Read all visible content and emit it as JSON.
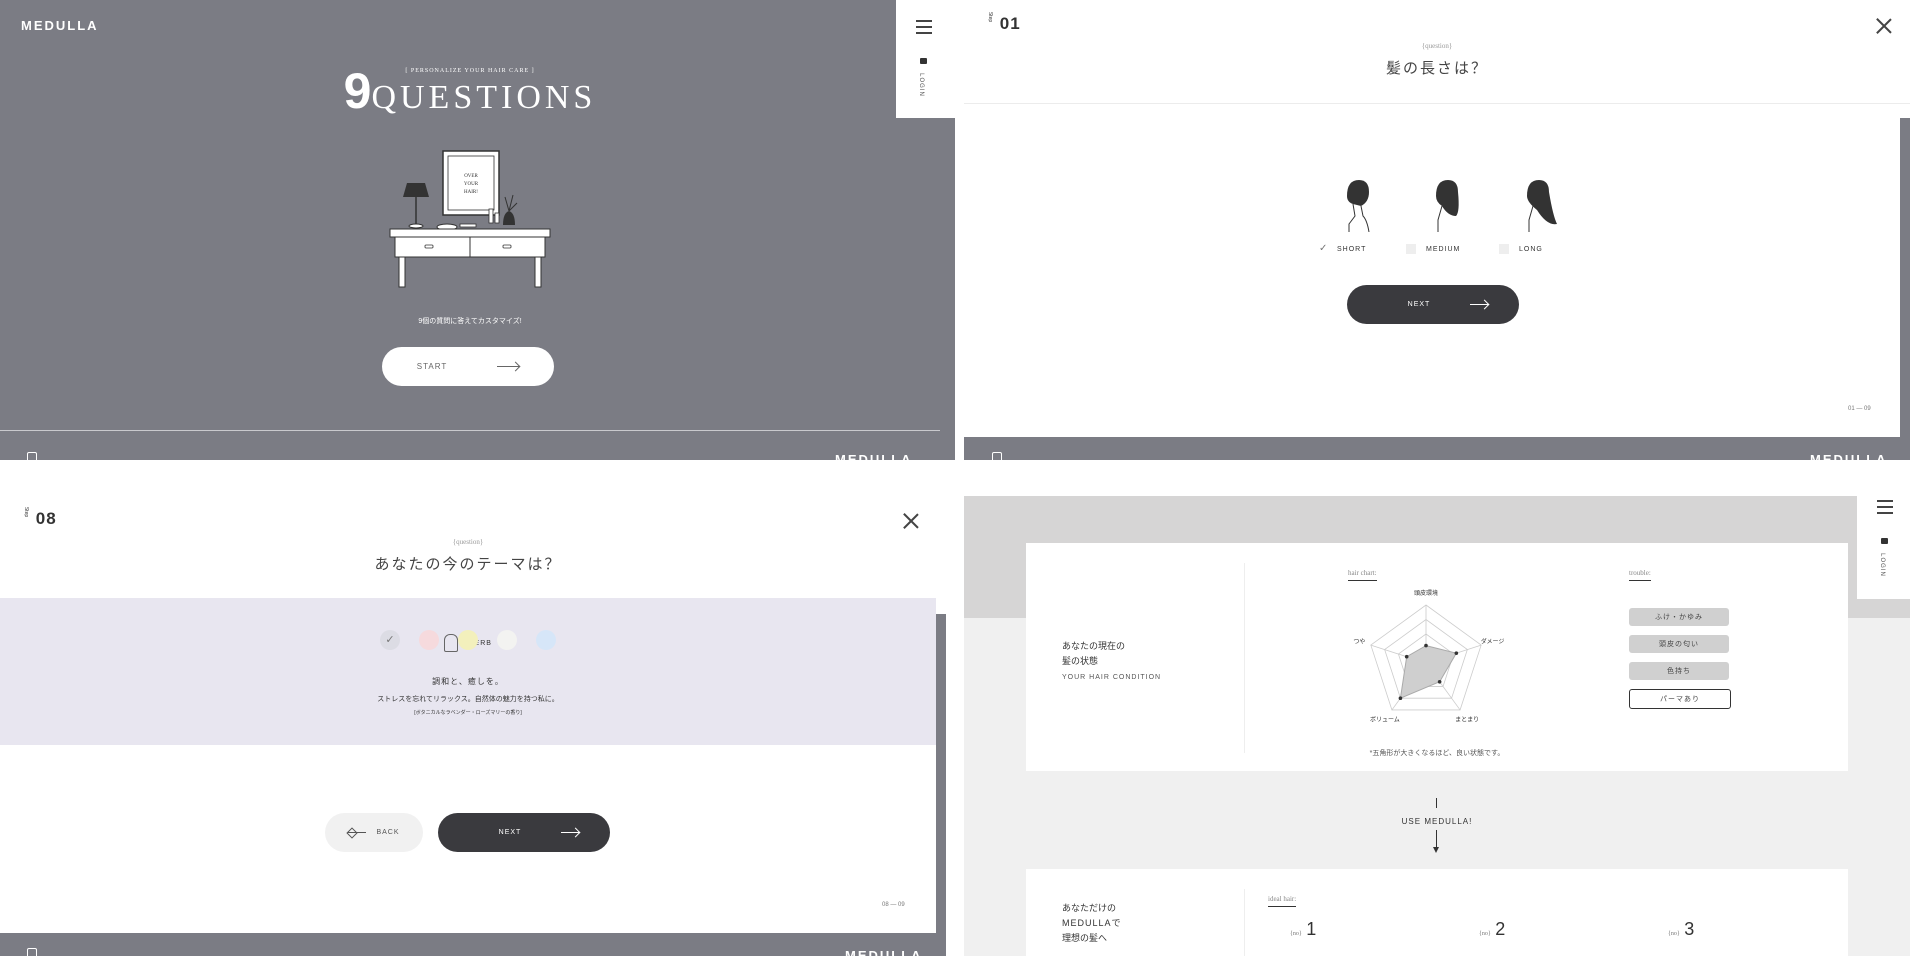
{
  "panel1": {
    "logo": "MEDULLA",
    "tagline": "[ PERSONALIZE YOUR HAIR CARE ]",
    "title_num": "9",
    "title_word": "QUESTIONS",
    "mirror_text": [
      "OVER",
      "YOUR",
      "HAIR!"
    ],
    "subtitle": "9個の質問に答えてカスタマイズ!",
    "start_label": "START",
    "login_label": "LOGIN",
    "footer_logo": "MEDULLA"
  },
  "panel2": {
    "step_prefix": "Step",
    "step_num": "01",
    "question_label": "{question}",
    "question": "髪の長さは？",
    "options": [
      {
        "label": "SHORT",
        "checked": true
      },
      {
        "label": "MEDIUM",
        "checked": false
      },
      {
        "label": "LONG",
        "checked": false
      }
    ],
    "next_label": "NEXT",
    "pager": "01 — 09",
    "footer_logo": "MEDULLA"
  },
  "panel3": {
    "step_prefix": "Step",
    "step_num": "08",
    "question_label": "{question}",
    "question": "あなたの今のテーマは？",
    "theme_name": "HERB",
    "theme_heading": "調和と、癒しを。",
    "theme_desc": "ストレスを忘れてリラックス。自然体の魅力を持つ私に。",
    "theme_note": "[ボタニカルなラベンダー・ローズマリーの香り]",
    "swatches": [
      {
        "color": "#dcdce4",
        "checked": true
      },
      {
        "color": "#f6dadd",
        "checked": false
      },
      {
        "color": "#f3f0bc",
        "checked": false
      },
      {
        "color": "#f3f3f1",
        "checked": false
      },
      {
        "color": "#d6e6f8",
        "checked": false
      }
    ],
    "back_label": "BACK",
    "next_label": "NEXT",
    "pager": "08 — 09",
    "footer_logo": "MEDULLA"
  },
  "panel4": {
    "login_label": "LOGIN",
    "condition_title_1": "あなたの現在の",
    "condition_title_2": "髪の状態",
    "condition_en": "YOUR HAIR CONDITION",
    "chart_label": "hair chart:",
    "trouble_label": "trouble:",
    "chart_data": {
      "type": "radar",
      "axes": [
        "頭皮環境",
        "ダメージ",
        "まとまり",
        "ボリューム",
        "つや"
      ],
      "values": [
        0.3,
        0.55,
        0.4,
        0.75,
        0.35
      ],
      "max": 1
    },
    "troubles": [
      {
        "label": "ふけ・かゆみ",
        "active": true
      },
      {
        "label": "頭皮の匂い",
        "active": true
      },
      {
        "label": "色持ち",
        "active": true
      },
      {
        "label": "パーマあり",
        "active": false
      }
    ],
    "chart_note": "*五角形が大きくなるほど、良い状態です。",
    "use_label": "USE MEDULLA!",
    "ideal_title_1": "あなただけの",
    "ideal_title_2": "MEDULLAで",
    "ideal_title_3": "理想の髪へ",
    "ideal_label": "ideal hair:",
    "ideal_items": [
      {
        "prefix": "{no}",
        "num": "1"
      },
      {
        "prefix": "{no}",
        "num": "2"
      },
      {
        "prefix": "{no}",
        "num": "3"
      }
    ]
  }
}
